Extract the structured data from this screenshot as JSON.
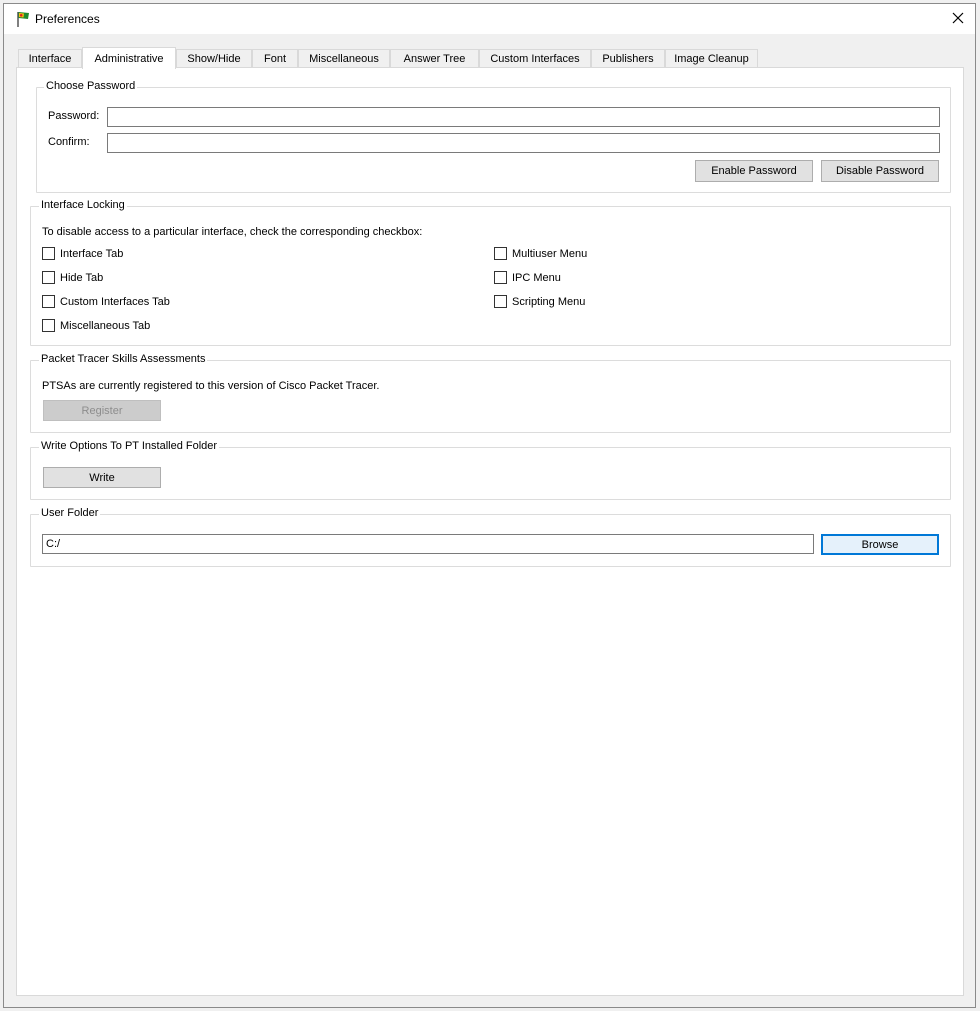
{
  "window": {
    "title": "Preferences",
    "icons": {
      "app": "packet-tracer-flag-icon",
      "close": "close-icon"
    }
  },
  "tabs": [
    {
      "label": "Interface"
    },
    {
      "label": "Administrative"
    },
    {
      "label": "Show/Hide"
    },
    {
      "label": "Font"
    },
    {
      "label": "Miscellaneous"
    },
    {
      "label": "Answer Tree"
    },
    {
      "label": "Custom Interfaces"
    },
    {
      "label": "Publishers"
    },
    {
      "label": "Image Cleanup"
    }
  ],
  "active_tab": "Administrative",
  "password": {
    "title": "Choose Password",
    "password_label": "Password:",
    "password_value": "",
    "confirm_label": "Confirm:",
    "confirm_value": "",
    "enable_label": "Enable Password",
    "disable_label": "Disable Password"
  },
  "locking": {
    "title": "Interface Locking",
    "instruction": "To disable access to a particular interface, check the corresponding checkbox:",
    "left": [
      {
        "label": "Interface Tab",
        "checked": false
      },
      {
        "label": "Hide Tab",
        "checked": false
      },
      {
        "label": "Custom Interfaces Tab",
        "checked": false
      },
      {
        "label": "Miscellaneous Tab",
        "checked": false
      }
    ],
    "right": [
      {
        "label": "Multiuser Menu",
        "checked": false
      },
      {
        "label": "IPC Menu",
        "checked": false
      },
      {
        "label": "Scripting Menu",
        "checked": false
      }
    ]
  },
  "ptsa": {
    "title": "Packet Tracer Skills Assessments",
    "status": "PTSAs are currently registered to this version of Cisco Packet Tracer.",
    "register_label": "Register"
  },
  "write_options": {
    "title": "Write Options To PT Installed Folder",
    "write_label": "Write"
  },
  "user_folder": {
    "title": "User Folder",
    "path": "C:/",
    "browse_label": "Browse"
  }
}
